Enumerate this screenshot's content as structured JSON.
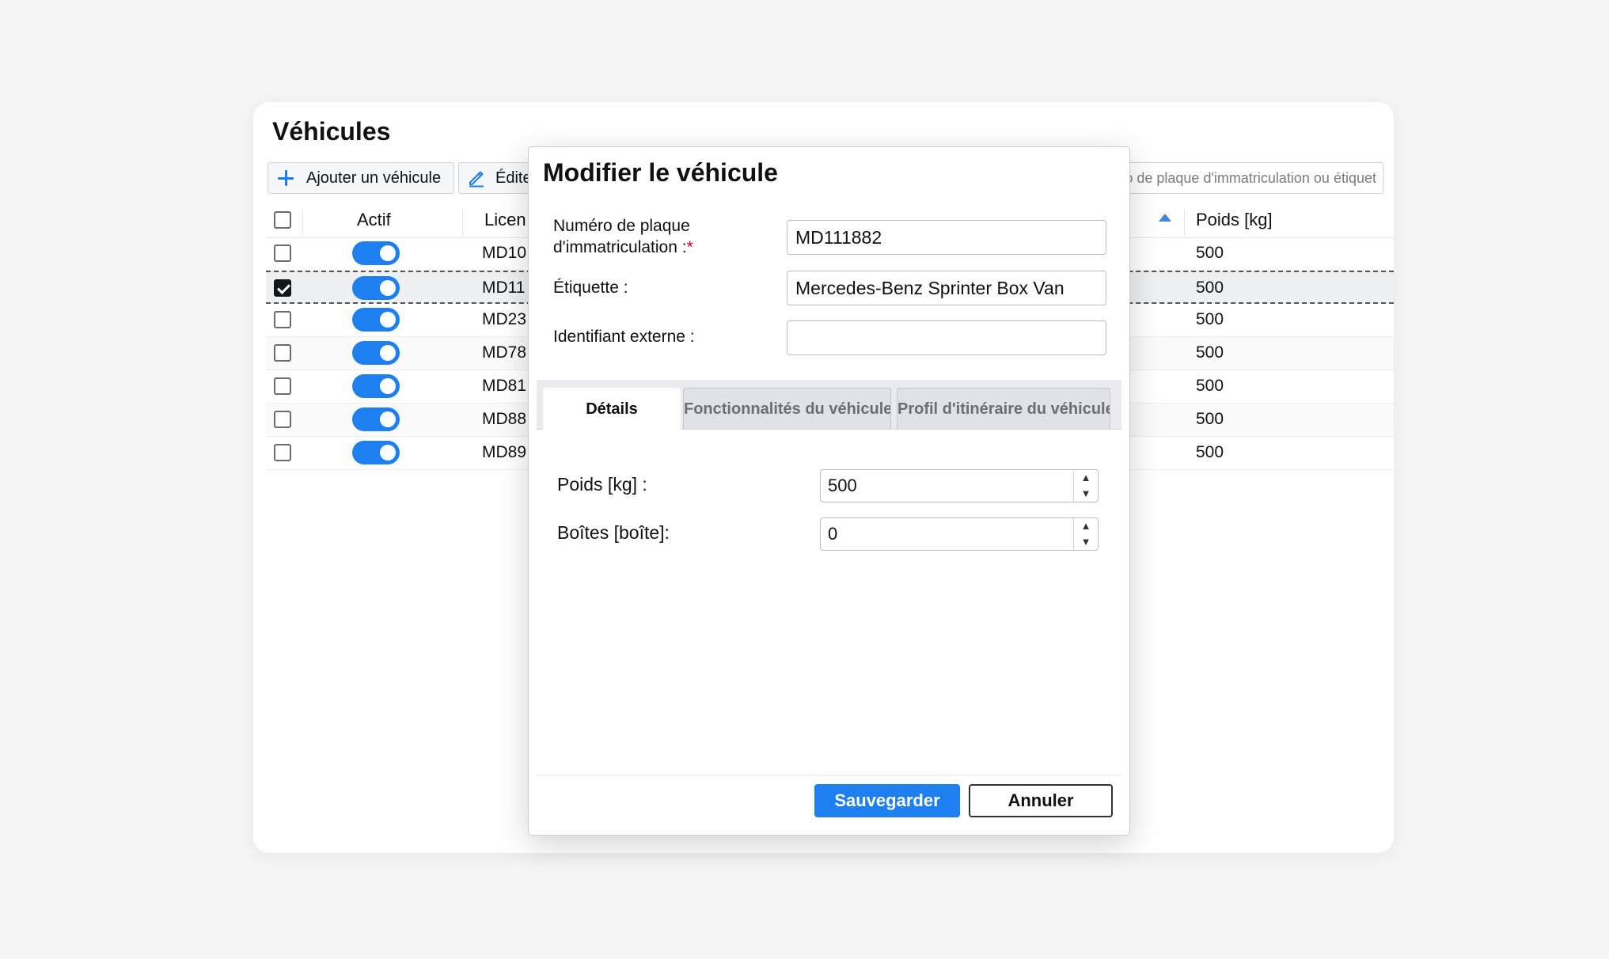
{
  "page": {
    "title": "Véhicules"
  },
  "toolbar": {
    "add_label": "Ajouter un véhicule",
    "edit_label": "Éditer",
    "search_placeholder": "Recherche par numéro de plaque d'immatriculation ou étiquet..."
  },
  "table": {
    "columns": [
      "Actif",
      "Licen",
      "Poids [kg]"
    ],
    "rows": [
      {
        "plate": "MD10",
        "active": true,
        "checked": false,
        "weight": "500"
      },
      {
        "plate": "MD11",
        "active": true,
        "checked": true,
        "weight": "500"
      },
      {
        "plate": "MD23",
        "active": true,
        "checked": false,
        "weight": "500"
      },
      {
        "plate": "MD78",
        "active": true,
        "checked": false,
        "weight": "500"
      },
      {
        "plate": "MD81",
        "active": true,
        "checked": false,
        "weight": "500"
      },
      {
        "plate": "MD88",
        "active": true,
        "checked": false,
        "weight": "500"
      },
      {
        "plate": "MD89",
        "active": true,
        "checked": false,
        "weight": "500"
      }
    ]
  },
  "modal": {
    "title": "Modifier le véhicule",
    "plate_label_line1": "Numéro de plaque",
    "plate_label_line2": "d'immatriculation :",
    "required_mark": "*",
    "plate_value": "MD111882",
    "label_label": "Étiquette :",
    "label_value": "Mercedes-Benz Sprinter Box Van",
    "external_id_label": "Identifiant externe :",
    "external_id_value": "",
    "tabs": [
      "Détails",
      "Fonctionnalités du véhicule",
      "Profil d'itinéraire du véhicule"
    ],
    "weight_label": "Poids [kg] :",
    "weight_value": "500",
    "boxes_label": "Boîtes [boîte]:",
    "boxes_value": "0",
    "save_label": "Sauvegarder",
    "cancel_label": "Annuler"
  },
  "colors": {
    "accent": "#1e7ff0",
    "checkbox_checked": "#14161a"
  }
}
